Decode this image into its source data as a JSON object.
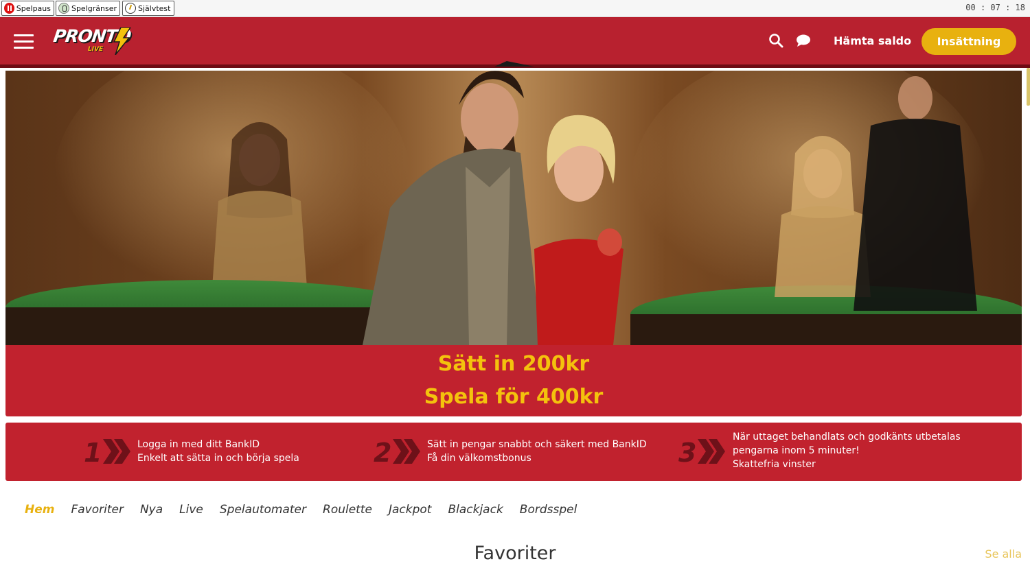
{
  "rg_bar": {
    "buttons": [
      {
        "label": "Spelpaus",
        "icon": "pause-icon"
      },
      {
        "label": "Spelgränser",
        "icon": "limits-icon"
      },
      {
        "label": "Självtest",
        "icon": "self-test-icon"
      }
    ],
    "clock": "00 : 07 : 18"
  },
  "header": {
    "logo_text": "PRONTO",
    "logo_sub": "LIVE",
    "balance_label": "Hämta saldo",
    "deposit_label": "Insättning",
    "colors": {
      "primary": "#b8212f",
      "accent": "#e8b10f"
    }
  },
  "hero": {
    "line1": "Sätt in 200kr",
    "line2": "Spela för 400kr"
  },
  "steps": [
    {
      "num": "1",
      "lines": [
        "Logga in med ditt BankID",
        "Enkelt att sätta in och börja spela"
      ]
    },
    {
      "num": "2",
      "lines": [
        "Sätt in pengar snabbt och säkert med BankID",
        "Få din välkomstbonus"
      ]
    },
    {
      "num": "3",
      "lines": [
        "När uttaget behandlats och godkänts utbetalas",
        "pengarna inom 5 minuter!",
        "Skattefria vinster"
      ]
    }
  ],
  "nav": {
    "tabs": [
      "Hem",
      "Favoriter",
      "Nya",
      "Live",
      "Spelautomater",
      "Roulette",
      "Jackpot",
      "Blackjack",
      "Bordsspel"
    ],
    "active": "Hem"
  },
  "section": {
    "title": "Favoriter",
    "see_all": "Se alla"
  }
}
